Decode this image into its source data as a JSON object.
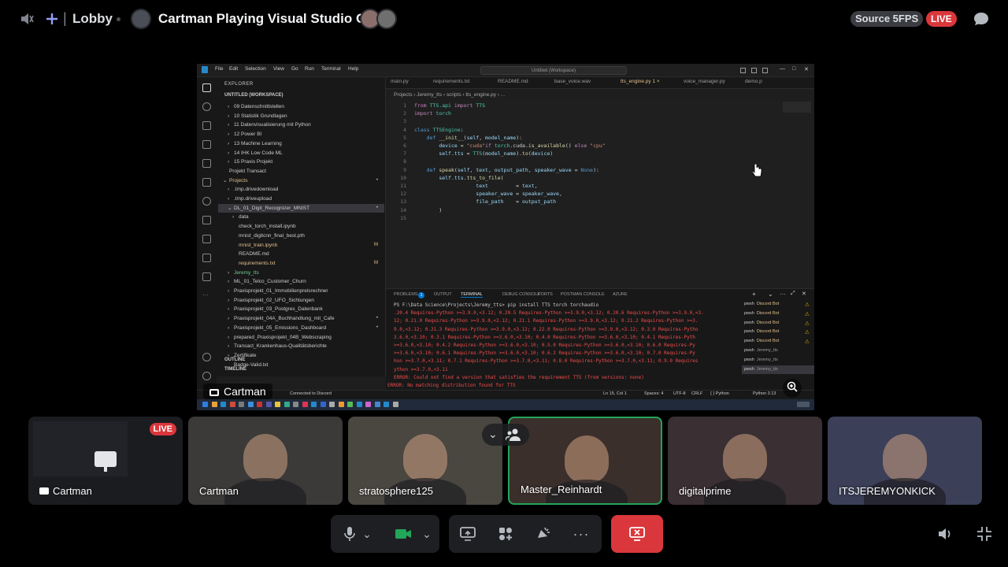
{
  "topbar": {
    "channel_icon": "speaker-icon",
    "add_icon": "plus-icon",
    "channel_name": "Lobby",
    "stream_title": "Cartman Playing Visual Studio Code",
    "source_label": "Source 5FPS",
    "live_label": "LIVE",
    "chat_icon": "chat-bubble-icon"
  },
  "vscode": {
    "menu": [
      "File",
      "Edit",
      "Selection",
      "View",
      "Go",
      "Run",
      "Terminal",
      "Help"
    ],
    "search_text": "Untitled (Workspace)",
    "explorer_label": "EXPLORER",
    "workspace_label": "UNTITLED (WORKSPACE)",
    "tree": [
      {
        "label": "09 Datenschnittstellen",
        "indent": 1,
        "chevron": "›"
      },
      {
        "label": "10 Statistik Grundlagen",
        "indent": 1,
        "chevron": "›"
      },
      {
        "label": "11 Datenvisualisierung mit Python",
        "indent": 1,
        "chevron": "›"
      },
      {
        "label": "12 Power BI",
        "indent": 1,
        "chevron": "›"
      },
      {
        "label": "13 Machine Learning",
        "indent": 1,
        "chevron": "›"
      },
      {
        "label": "14 IHK Low Code ML",
        "indent": 1,
        "chevron": "›"
      },
      {
        "label": "15 Praxis Projekt",
        "indent": 1,
        "chevron": "›"
      },
      {
        "label": "Projekt Transact",
        "indent": 0,
        "chevron": ""
      },
      {
        "label": "Projects",
        "indent": 0,
        "chevron": "⌄",
        "color": "yellow",
        "mark": "•"
      },
      {
        "label": ".tmp.drivedownload",
        "indent": 1,
        "chevron": "›"
      },
      {
        "label": ".tmp.driveupload",
        "indent": 1,
        "chevron": "›"
      },
      {
        "label": "DL_01_Digit_Recognizer_MNIST",
        "indent": 1,
        "chevron": "⌄",
        "selected": true,
        "mark": "•"
      },
      {
        "label": "data",
        "indent": 2,
        "chevron": "›"
      },
      {
        "label": "check_torch_install.ipynb",
        "indent": 2,
        "chevron": ""
      },
      {
        "label": "mnist_digitcnn_final_best.pth",
        "indent": 2,
        "chevron": ""
      },
      {
        "label": "mnist_train.ipynb",
        "indent": 2,
        "chevron": "",
        "color": "yellow",
        "mark": "M"
      },
      {
        "label": "README.md",
        "indent": 2,
        "chevron": ""
      },
      {
        "label": "requirements.txt",
        "indent": 2,
        "chevron": "",
        "color": "yellow",
        "mark": "M"
      },
      {
        "label": "Jeremy_tts",
        "indent": 1,
        "chevron": "›",
        "color": "green"
      },
      {
        "label": "ML_01_Telco_Customer_Churn",
        "indent": 1,
        "chevron": "›"
      },
      {
        "label": "Praxisprojekt_01_Immobilienpreisrechner",
        "indent": 1,
        "chevron": "›"
      },
      {
        "label": "Praxisprojekt_02_UFO_Sichtungen",
        "indent": 1,
        "chevron": "›"
      },
      {
        "label": "Praxisprojekt_03_Postgres_Datenbank",
        "indent": 1,
        "chevron": "›"
      },
      {
        "label": "Praxisprojekt_04A_Buchhandlung_mit_Cafe",
        "indent": 1,
        "chevron": "›",
        "mark": "•"
      },
      {
        "label": "Praxisprojekt_05_Emissions_Dashboard",
        "indent": 1,
        "chevron": "›",
        "mark": "•"
      },
      {
        "label": "prepared_Praxisprojekt_04B_Webscraping",
        "indent": 1,
        "chevron": "›"
      },
      {
        "label": "Transact_Krankenhaus-Qualitätsberichte",
        "indent": 1,
        "chevron": "›"
      },
      {
        "label": "Zertifikate",
        "indent": 1,
        "chevron": "›"
      },
      {
        "label": "Badge-Valid.txt",
        "indent": 1,
        "chevron": ""
      }
    ],
    "outline_label": "OUTLINE",
    "timeline_label": "TIMELINE",
    "tabs": [
      {
        "label": "main.py",
        "active": false
      },
      {
        "label": "requirements.txt",
        "active": false
      },
      {
        "label": "README.md",
        "active": false
      },
      {
        "label": "base_voice.wav",
        "active": false
      },
      {
        "label": "tts_engine.py 1  ×",
        "active": true
      },
      {
        "label": "voice_manager.py",
        "active": false
      },
      {
        "label": "demo.p",
        "active": false
      }
    ],
    "breadcrumb": "Projects › Jeremy_tts › scripts › tts_engine.py › ...",
    "code": [
      {
        "n": "1",
        "html": "<span class='kw'>from</span> <span class='cls'>TTS.api</span> <span class='kw'>import</span> <span class='cls'>TTS</span>"
      },
      {
        "n": "2",
        "html": "<span class='kw'>import</span> <span class='cls'>torch</span>"
      },
      {
        "n": "3",
        "html": ""
      },
      {
        "n": "4",
        "html": "<span class='kw2'>class</span> <span class='cls'>TTSEngine</span><span class='pl'>:</span>"
      },
      {
        "n": "5",
        "html": "    <span class='kw2'>def</span> <span class='fn'>__init__</span><span class='pl'>(</span><span class='var'>self</span><span class='pl'>, </span><span class='var'>model_name</span><span class='pl'>):</span>"
      },
      {
        "n": "6",
        "html": "        <span class='var'>device</span> <span class='pl'>=</span> <span class='str'>\"cuda\"</span><span class='kw'>if</span> <span class='cls'>torch</span><span class='pl'>.cuda.</span><span class='fn'>is_available</span><span class='pl'>()</span> <span class='kw'>else</span> <span class='str'>\"cpu\"</span>"
      },
      {
        "n": "7",
        "html": "        <span class='var'>self</span><span class='pl'>.</span><span class='var'>tts</span> <span class='pl'>=</span> <span class='cls'>TTS</span><span class='pl'>(</span><span class='var'>model_name</span><span class='pl'>).</span><span class='fn'>to</span><span class='pl'>(</span><span class='var'>device</span><span class='pl'>)</span>"
      },
      {
        "n": "8",
        "html": ""
      },
      {
        "n": "9",
        "html": "    <span class='kw2'>def</span> <span class='fn'>speak</span><span class='pl'>(</span><span class='var'>self</span><span class='pl'>, </span><span class='var'>text</span><span class='pl'>, </span><span class='var'>output_path</span><span class='pl'>, </span><span class='var'>speaker_wave</span> <span class='pl'>=</span> <span class='kw2'>None</span><span class='pl'>):</span>"
      },
      {
        "n": "10",
        "html": "        <span class='var'>self</span><span class='pl'>.</span><span class='var'>tts</span><span class='pl'>.</span><span class='fn'>tts_to_file</span><span class='pl'>(</span>"
      },
      {
        "n": "11",
        "html": "                    <span class='var'>text</span>         <span class='pl'>=</span> <span class='var'>text</span><span class='pl'>,</span>"
      },
      {
        "n": "12",
        "html": "                    <span class='var'>speaker_wave</span> <span class='pl'>=</span> <span class='var'>speaker_wave</span><span class='pl'>,</span>"
      },
      {
        "n": "13",
        "html": "                    <span class='var'>file_path</span>    <span class='pl'>=</span> <span class='var'>output_path</span>"
      },
      {
        "n": "14",
        "html": "        <span class='pl'>)</span>"
      },
      {
        "n": "15",
        "html": ""
      }
    ],
    "panel_tabs": [
      "PROBLEMS",
      "OUTPUT",
      "TERMINAL",
      "DEBUG CONSOLE",
      "PORTS",
      "POSTMAN CONSOLE",
      "AZURE"
    ],
    "problems_count": "1",
    "terminal": [
      {
        "text": "PS F:\\Data Science\\Projects\\Jeremy_tts> pip install TTS torch torchaudio",
        "cmd": true
      },
      {
        "text": ".20.4 Requires-Python >=3.9.0,<3.12; 0.20.5 Requires-Python >=3.9.0,<3.12; 0.20.6 Requires-Python >=3.9.0,<3.",
        "cmd": false
      },
      {
        "text": "12; 0.21.0 Requires-Python >=3.9.0,<3.12; 0.21.1 Requires-Python >=3.9.0,<3.12; 0.21.2 Requires-Python >=3.",
        "cmd": false
      },
      {
        "text": "9.0,<3.12; 0.21.3 Requires-Python >=3.9.0,<3.12; 0.22.0 Requires-Python >=3.9.0,<3.12; 0.3.0 Requires-Pytho",
        "cmd": false
      },
      {
        "text": "3.6.0,<3.10; 0.3.1 Requires-Python >=3.6.0,<3.10; 0.4.0 Requires-Python >=3.6.0,<3.10; 0.4.1 Requires-Pyth",
        "cmd": false
      },
      {
        "text": ">=3.6.0,<3.10; 0.4.2 Requires-Python >=3.6.0,<3.10; 0.5.0 Requires-Python >=3.6.0,<3.10; 0.6.0 Requires-Py",
        "cmd": false
      },
      {
        "text": ">=3.6.0,<3.10; 0.6.1 Requires-Python >=3.6.0,<3.10; 0.6.2 Requires-Python >=3.6.0,<3.10; 0.7.0 Requires-Py",
        "cmd": false
      },
      {
        "text": "hon >=3.7.0,<3.11; 0.7.1 Requires-Python >=3.7.0,<3.11; 0.8.0 Requires-Python >=3.7.0,<3.11; 0.9.0 Requires",
        "cmd": false
      },
      {
        "text": "ython >=3.7.0,<3.11",
        "cmd": false
      },
      {
        "text": "ERROR: Could not find a version that satisfies the requirement TTS (from versions: none)",
        "cmd": false
      },
      {
        "text": "ERROR: No matching distribution found for TTS",
        "cmd": false
      },
      {
        "text": "PS F:\\Data Science\\Projects\\Jeremy_tts> ",
        "cmd": true
      }
    ],
    "terminals": [
      {
        "name": "pwsh",
        "sub": "Discord Bot",
        "warn": true
      },
      {
        "name": "pwsh",
        "sub": "Discord Bot",
        "warn": true
      },
      {
        "name": "pwsh",
        "sub": "Discord Bot",
        "warn": true
      },
      {
        "name": "pwsh",
        "sub": "Discord Bot",
        "warn": true
      },
      {
        "name": "pwsh",
        "sub": "Discord Bot",
        "warn": true
      },
      {
        "name": "pwsh",
        "sub": "Jeremy_tts",
        "warn": false
      },
      {
        "name": "pwsh",
        "sub": "Jeremy_tts",
        "warn": false
      },
      {
        "name": "pwsh",
        "sub": "Jeremy_tts",
        "warn": false
      }
    ],
    "status": {
      "connected": "Connected to Discord",
      "position": "Ln 15, Col 1",
      "spaces": "Spaces: 4",
      "encoding": "UTF-8",
      "eol": "CRLF",
      "lang": "{ }  Python",
      "interpreter": "Python 3.13"
    }
  },
  "screen_owner": "Cartman",
  "participants": [
    {
      "name": "Cartman",
      "live": "LIVE",
      "kind": "screen",
      "bg": "#1b1c20"
    },
    {
      "name": "Cartman",
      "kind": "cam",
      "bg": "#3b3a38"
    },
    {
      "name": "stratosphere125",
      "kind": "cam",
      "bg": "#4a4640"
    },
    {
      "name": "Master_Reinhardt",
      "kind": "cam",
      "bg": "#3b2f2c",
      "selected": true
    },
    {
      "name": "digitalprime",
      "kind": "cam",
      "bg": "#3a2f33"
    },
    {
      "name": "ITSJEREMYONKICK",
      "kind": "cam",
      "bg": "#3b3f57"
    }
  ],
  "controls": {
    "mic_icon": "microphone-icon",
    "camera_icon": "camera-icon",
    "share_icon": "screen-share-icon",
    "activities_icon": "activities-icon",
    "soundboard_icon": "soundboard-icon",
    "more_icon": "more-icon",
    "leave_icon": "leave-stream-icon",
    "volume_icon": "volume-icon",
    "fullscreen_icon": "fullscreen-exit-icon"
  }
}
